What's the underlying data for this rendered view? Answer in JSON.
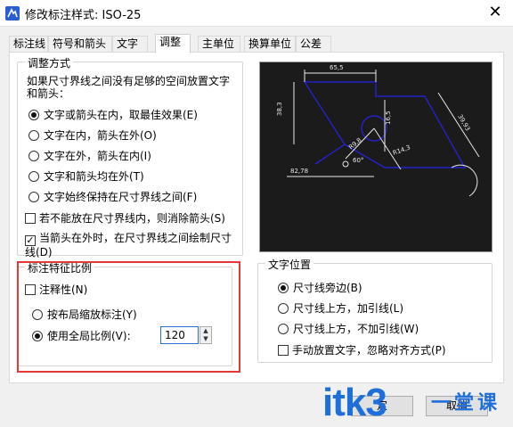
{
  "window": {
    "title": "修改标注样式: ISO-25",
    "close_glyph": "✕"
  },
  "tabs": [
    {
      "label": "标注线"
    },
    {
      "label": "符号和箭头"
    },
    {
      "label": "文字"
    },
    {
      "label": "调整"
    },
    {
      "label": "主单位"
    },
    {
      "label": "换算单位"
    },
    {
      "label": "公差"
    }
  ],
  "active_tab": "调整",
  "fit_group": {
    "title": "调整方式",
    "description": "如果尺寸界线之间没有足够的空间放置文字和箭头：",
    "options": [
      {
        "label": "文字或箭头在内，取最佳效果(E)",
        "selected": true
      },
      {
        "label": "文字在内，箭头在外(O)",
        "selected": false
      },
      {
        "label": "文字在外，箭头在内(I)",
        "selected": false
      },
      {
        "label": "文字和箭头均在外(T)",
        "selected": false
      },
      {
        "label": "文字始终保持在尺寸界线之间(F)",
        "selected": false
      }
    ],
    "suppress_arrows": {
      "label": "若不能放在尺寸界线内，则消除箭头(S)",
      "checked": false
    },
    "draw_line_between": {
      "label": "当箭头在外时，在尺寸界线之间绘制尺寸线(D)",
      "checked": true
    }
  },
  "preview": {
    "labels": {
      "top": "65,5",
      "left": "38,3",
      "right_top": "39,93",
      "center": "16,5",
      "angle": "60°",
      "r1": "R9,8",
      "r2": "R14,3",
      "bottom": "82,78"
    },
    "colors": {
      "bg": "#1b1b1b",
      "shape": "#2323c8",
      "dim": "#e8e8e8"
    }
  },
  "scale_group": {
    "title": "标注特征比例",
    "annotative": {
      "label": "注释性(N)",
      "checked": false
    },
    "options": [
      {
        "label": "按布局缩放标注(Y)",
        "selected": false
      },
      {
        "label": "使用全局比例(V):",
        "selected": true
      }
    ],
    "global_scale_value": "120"
  },
  "text_position_group": {
    "title": "文字位置",
    "options": [
      {
        "label": "尺寸线旁边(B)",
        "selected": true
      },
      {
        "label": "尺寸线上方，加引线(L)",
        "selected": false
      },
      {
        "label": "尺寸线上方，不加引线(W)",
        "selected": false
      }
    ],
    "manual_place": {
      "label": "手动放置文字，忽略对齐方式(P)",
      "checked": false
    }
  },
  "buttons": {
    "ok_partial": "定",
    "cancel": "取消"
  },
  "watermark": {
    "text": "itk3",
    "sub": "一堂课"
  },
  "colors": {
    "highlight_border": "#e53935",
    "watermark": "#1e6fd9"
  }
}
